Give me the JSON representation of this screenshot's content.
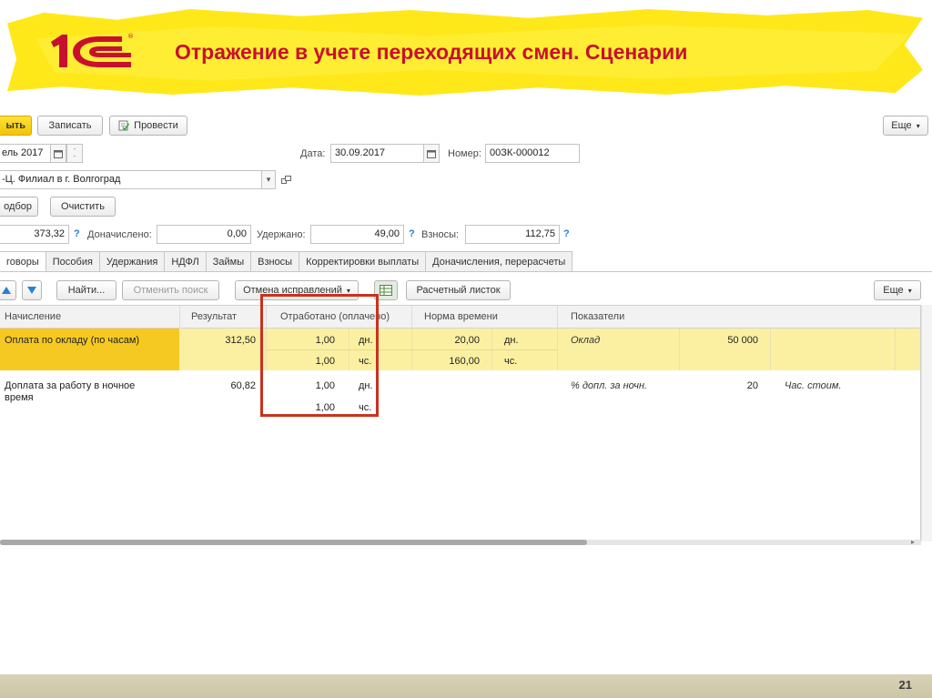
{
  "slide": {
    "title": "Отражение в учете переходящих смен. Сценарии",
    "page_number": "21",
    "logo_text": "1С",
    "colors": {
      "title": "#c8102e",
      "highlight": "#ffe81a",
      "logo": "#c8102e",
      "red_box": "#c8321e"
    }
  },
  "toolbar": {
    "post_close_label": "ыть",
    "save_label": "Записать",
    "post_label": "Провести",
    "more_label": "Еще"
  },
  "header": {
    "month_value": "ель 2017",
    "date_label": "Дата:",
    "date_value": "30.09.2017",
    "number_label": "Номер:",
    "number_value": "00ЗК-000012",
    "org_value": "-Ц. Филиал в г. Волгоград",
    "pick_label": "одбор",
    "clear_label": "Очистить"
  },
  "totals": {
    "accrued_value": "373,32",
    "additional_label": "Доначислено:",
    "additional_value": "0,00",
    "withheld_label": "Удержано:",
    "withheld_value": "49,00",
    "contrib_label": "Взносы:",
    "contrib_value": "112,75",
    "help": "?"
  },
  "tabs": [
    "говоры",
    "Пособия",
    "Удержания",
    "НДФЛ",
    "Займы",
    "Взносы",
    "Корректировки выплаты",
    "Доначисления, перерасчеты"
  ],
  "grid_toolbar": {
    "find_label": "Найти...",
    "cancel_search_label": "Отменить поиск",
    "cancel_corrections_label": "Отмена исправлений",
    "payslip_label": "Расчетный листок",
    "more_label": "Еще"
  },
  "grid": {
    "columns": [
      "Начисление",
      "Результат",
      "Отработано (оплачено)",
      "Норма времени",
      "Показатели"
    ],
    "rows": [
      {
        "accrual": "Оплата по окладу (по часам)",
        "result": "312,50",
        "worked_days": "1,00",
        "days_unit": "дн.",
        "worked_hours": "1,00",
        "hours_unit": "чс.",
        "norm_days": "20,00",
        "norm_days_unit": "дн.",
        "norm_hours": "160,00",
        "norm_hours_unit": "чс.",
        "indicator_name": "Оклад",
        "indicator_value": "50 000",
        "indicator_extra": ""
      },
      {
        "accrual_line1": "Доплата за работу в ночное",
        "accrual_line2": "время",
        "result": "60,82",
        "worked_days": "1,00",
        "days_unit": "дн.",
        "worked_hours": "1,00",
        "hours_unit": "чс.",
        "indicator_name": "% допл. за ночн.",
        "indicator_value": "20",
        "indicator_extra": "Час. стоим."
      }
    ]
  }
}
